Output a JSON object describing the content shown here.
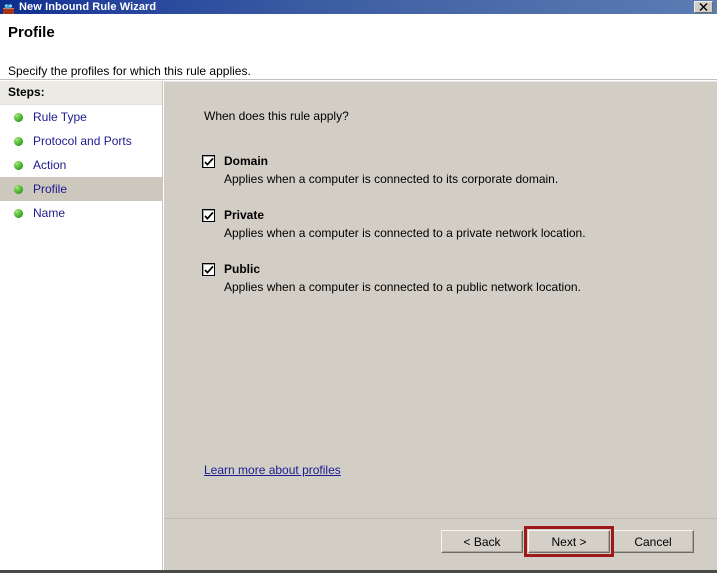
{
  "window": {
    "title": "New Inbound Rule Wizard",
    "icon": "firewall-rule-icon",
    "close_label": "✕"
  },
  "header": {
    "title": "Profile",
    "subtitle": "Specify the profiles for which this rule applies."
  },
  "sidebar": {
    "heading": "Steps:",
    "items": [
      {
        "label": "Rule Type",
        "active": false
      },
      {
        "label": "Protocol and Ports",
        "active": false
      },
      {
        "label": "Action",
        "active": false
      },
      {
        "label": "Profile",
        "active": true
      },
      {
        "label": "Name",
        "active": false
      }
    ]
  },
  "main": {
    "question": "When does this rule apply?",
    "profiles": [
      {
        "name": "Domain",
        "description": "Applies when a computer is connected to its corporate domain.",
        "checked": true
      },
      {
        "name": "Private",
        "description": "Applies when a computer is connected to a private network location.",
        "checked": true
      },
      {
        "name": "Public",
        "description": "Applies when a computer is connected to a public network location.",
        "checked": true
      }
    ],
    "learn_more_link": "Learn more about profiles"
  },
  "buttons": {
    "back": "< Back",
    "next": "Next >",
    "cancel": "Cancel"
  },
  "colors": {
    "titlebar_dark": "#0c2d8c",
    "titlebar_light": "#5c7cb5",
    "panel_background": "#d2cec5",
    "sidebar_background": "#ffffff",
    "active_step_background": "#ccc8bd",
    "link_text": "#1b1b8f",
    "highlight_border": "#9e1a1a",
    "step_bullet": "#57c23a"
  }
}
